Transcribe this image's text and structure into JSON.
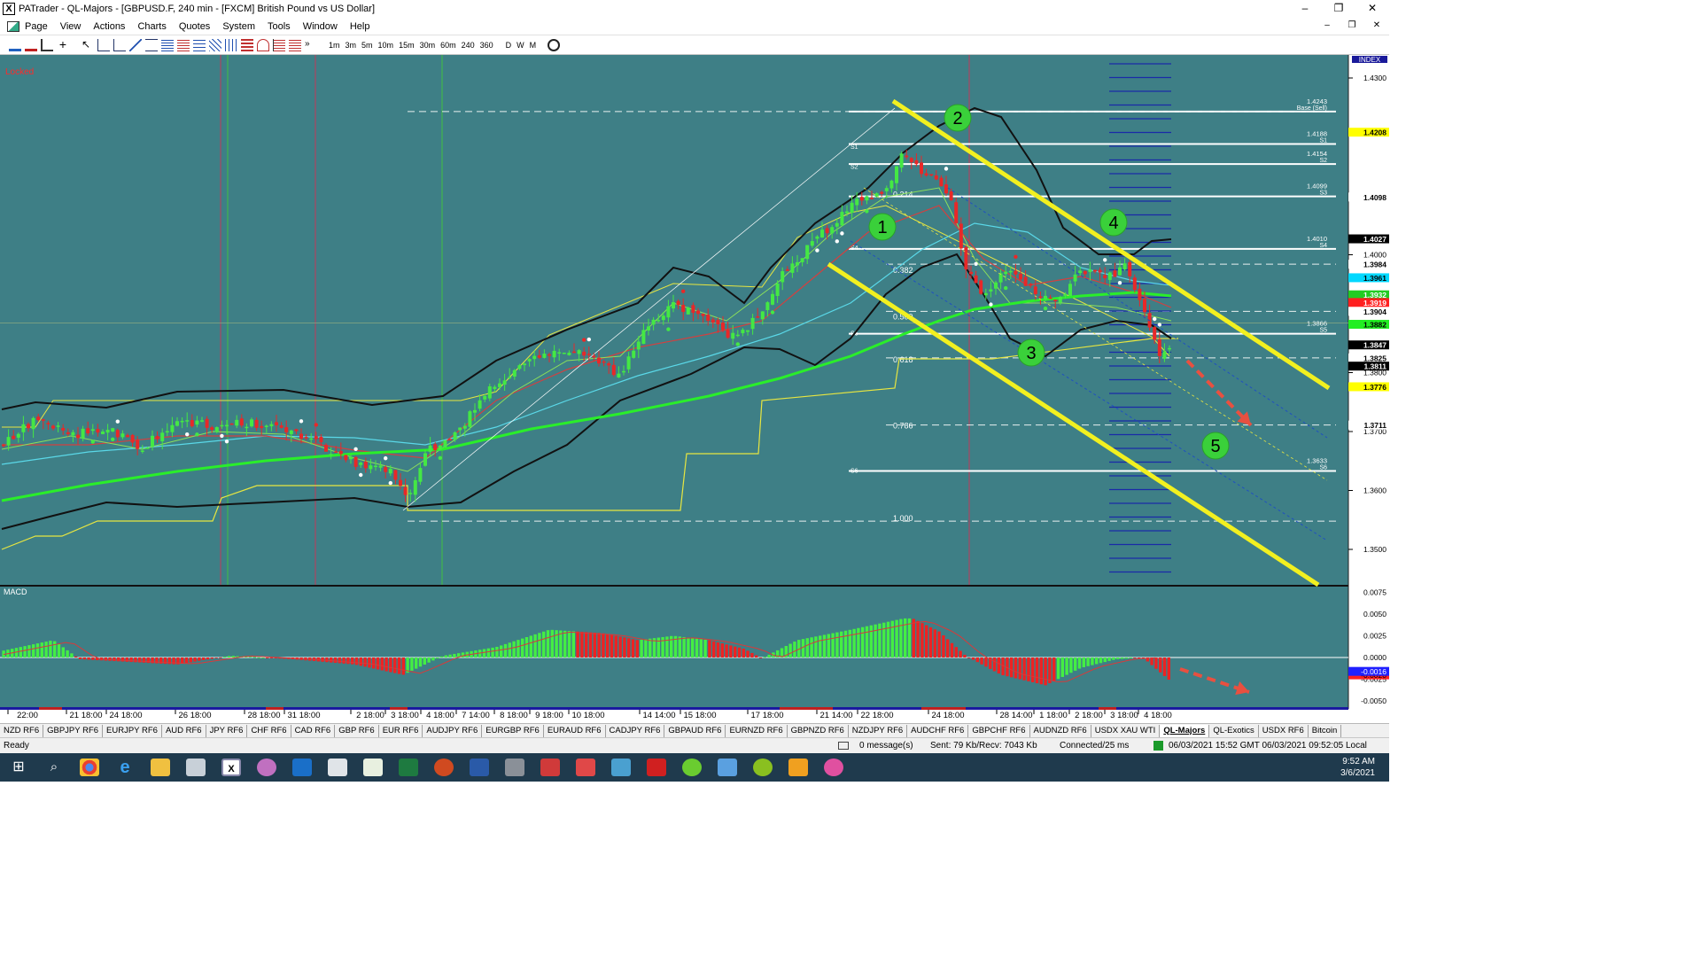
{
  "window": {
    "title": "PATrader - QL-Majors - [GBPUSD.F, 240 min - [FXCM] British Pound vs US Dollar]",
    "controls": [
      "–",
      "❐",
      "✕"
    ],
    "inner_controls": [
      "–",
      "❐",
      "✕"
    ]
  },
  "menu": [
    "Page",
    "View",
    "Actions",
    "Charts",
    "Quotes",
    "System",
    "Tools",
    "Window",
    "Help"
  ],
  "toolbar": {
    "timeframes": [
      "1m",
      "3m",
      "5m",
      "10m",
      "15m",
      "30m",
      "60m",
      "240",
      "360",
      "D",
      "W",
      "M"
    ]
  },
  "chart": {
    "locked_label": "Locked",
    "index_label": "INDEX",
    "macd_label": "MACD",
    "wave_labels": [
      "1",
      "2",
      "3",
      "4",
      "5"
    ],
    "fib_labels": [
      "0.214",
      "0.382",
      "0.500",
      "0.618",
      "0.786",
      "1.000"
    ],
    "pivot_left_labels": [
      "S1",
      "S2",
      "S4",
      "S5",
      "S6"
    ],
    "pivot_right_labels": [
      {
        "value": "1.4243",
        "tag": "Base (Sell)"
      },
      {
        "value": "1.4188",
        "tag": "S1"
      },
      {
        "value": "1.4154",
        "tag": "S2"
      },
      {
        "value": "1.4099",
        "tag": "S3"
      },
      {
        "value": "1.4010",
        "tag": "S4"
      },
      {
        "value": "1.3866",
        "tag": "S5"
      },
      {
        "value": "1.3633",
        "tag": "S6"
      }
    ],
    "price_axis": [
      "1.4300",
      "1.4000",
      "1.3800",
      "1.3700",
      "1.3600",
      "1.3500"
    ],
    "price_badges": [
      {
        "value": "1.4208",
        "bg": "#ffff00",
        "fg": "#000000"
      },
      {
        "value": "1.4098",
        "bg": "#ffffff",
        "fg": "#000000"
      },
      {
        "value": "1.4027",
        "bg": "#000000",
        "fg": "#ffffff"
      },
      {
        "value": "1.3984",
        "bg": "#ffffff",
        "fg": "#000000"
      },
      {
        "value": "1.3961",
        "bg": "#00d8ff",
        "fg": "#000000"
      },
      {
        "value": "1.3932",
        "bg": "#22cc22",
        "fg": "#ffffff"
      },
      {
        "value": "1.3919",
        "bg": "#ff2020",
        "fg": "#ffffff"
      },
      {
        "value": "1.3904",
        "bg": "#ffffff",
        "fg": "#000000"
      },
      {
        "value": "1.3882",
        "bg": "#22ee22",
        "fg": "#000000"
      },
      {
        "value": "1.3847",
        "bg": "#000000",
        "fg": "#ffffff"
      },
      {
        "value": "1.3825",
        "bg": "#ffffff",
        "fg": "#000000"
      },
      {
        "value": "1.3811",
        "bg": "#000000",
        "fg": "#ffffff"
      },
      {
        "value": "1.3776",
        "bg": "#ffff00",
        "fg": "#000000"
      },
      {
        "value": "1.3711",
        "bg": "#ffffff",
        "fg": "#000000"
      }
    ],
    "macd_axis": [
      "0.0075",
      "0.0050",
      "0.0025",
      "0.0000",
      "-0.0025",
      "-0.0050"
    ],
    "macd_badges": [
      {
        "value": "-0.0020",
        "bg": "#ff2020",
        "fg": "#000000"
      },
      {
        "value": "-0.0016",
        "bg": "#2020ff",
        "fg": "#ffffff"
      }
    ],
    "time_axis": [
      "22:00",
      "21 18:00",
      "24 18:00",
      "26 18:00",
      "28 18:00",
      "31 18:00",
      "2 18:00",
      "3 18:00",
      "4 18:00",
      "7 14:00",
      "8 18:00",
      "9 18:00",
      "10 18:00",
      "14 14:00",
      "15 18:00",
      "17 18:00",
      "21 14:00",
      "22 18:00",
      "24 18:00",
      "28 14:00",
      "1 18:00",
      "2 18:00",
      "3 18:00",
      "4 18:00"
    ]
  },
  "symbol_tabs": [
    "NZD RF6",
    "GBPJPY RF6",
    "EURJPY RF6",
    "AUD RF6",
    "JPY RF6",
    "CHF RF6",
    "CAD RF6",
    "GBP RF6",
    "EUR RF6",
    "AUDJPY RF6",
    "EURGBP RF6",
    "EURAUD RF6",
    "CADJPY RF6",
    "GBPAUD RF6",
    "EURNZD RF6",
    "GBPNZD RF6",
    "NZDJPY RF6",
    "AUDCHF RF6",
    "GBPCHF RF6",
    "AUDNZD RF6",
    "USDX XAU WTI",
    "QL-Majors",
    "QL-Exotics",
    "USDX RF6",
    "Bitcoin"
  ],
  "active_tab": "QL-Majors",
  "status": {
    "ready": "Ready",
    "messages": "0 message(s)",
    "traffic": "Sent: 79 Kb/Recv: 7043 Kb",
    "connection": "Connected/25 ms",
    "times": "06/03/2021 15:52 GMT  06/03/2021 09:52:05 Local"
  },
  "clock": {
    "time": "9:52 AM",
    "date": "3/6/2021"
  }
}
